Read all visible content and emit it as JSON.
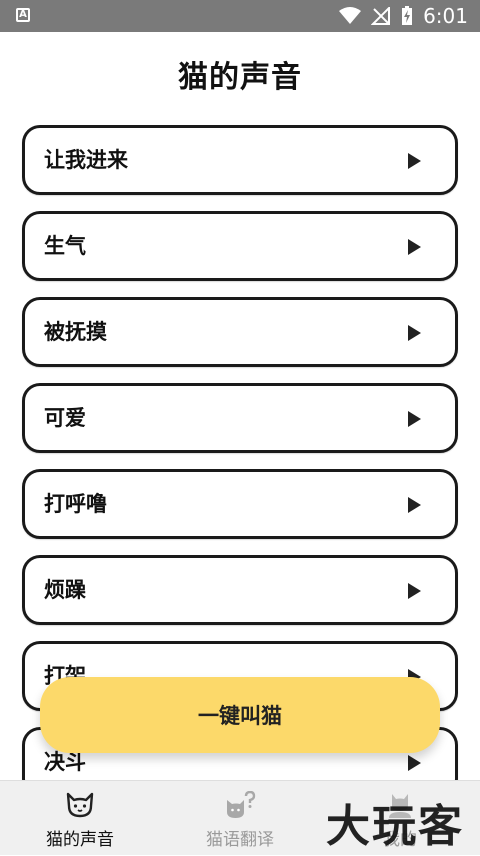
{
  "status_bar": {
    "time": "6:01",
    "left_badge": "A"
  },
  "page": {
    "title": "猫的声音"
  },
  "sounds": [
    {
      "label": "让我进来"
    },
    {
      "label": "生气"
    },
    {
      "label": "被抚摸"
    },
    {
      "label": "可爱"
    },
    {
      "label": "打呼噜"
    },
    {
      "label": "烦躁"
    },
    {
      "label": "打架"
    },
    {
      "label": "决斗"
    }
  ],
  "fab": {
    "label": "一键叫猫"
  },
  "bottom_nav": {
    "items": [
      {
        "label": "猫的声音",
        "icon": "cat-icon",
        "active": true
      },
      {
        "label": "猫语翻译",
        "icon": "cat-translate-icon",
        "active": false
      },
      {
        "label": "我的",
        "icon": "profile-icon",
        "active": false
      }
    ]
  },
  "watermark": {
    "text": "大玩客"
  },
  "colors": {
    "status_bar": "#7a7a7a",
    "fab": "#fcd96a",
    "border": "#1a1a1a"
  }
}
